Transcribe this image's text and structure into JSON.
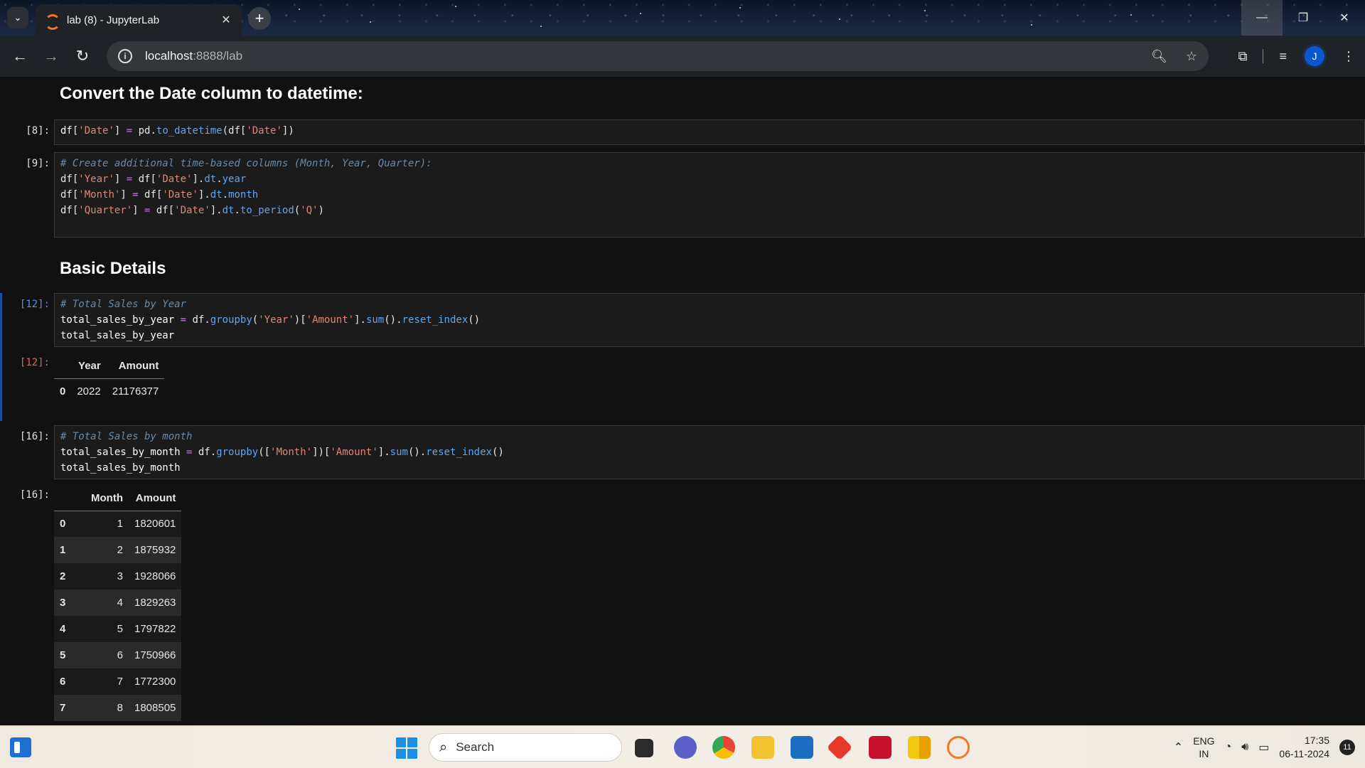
{
  "browser": {
    "tab_title": "lab (8) - JupyterLab",
    "new_tab_symbol": "+",
    "url_host": "localhost",
    "url_path": ":8888/lab",
    "profile_initial": "J"
  },
  "notebook": {
    "heading_date": "Convert the Date column to datetime:",
    "heading_basic": "Basic Details",
    "cells": {
      "c8_prompt": "[8]:",
      "c9_prompt": "[9]:",
      "c12_prompt": "[12]:",
      "c12_out_prompt": "[12]:",
      "c16_prompt": "[16]:",
      "c16_out_prompt": "[16]:"
    },
    "year_table": {
      "columns": [
        "Year",
        "Amount"
      ],
      "rows": [
        {
          "index": "0",
          "values": [
            "2022",
            "21176377"
          ]
        }
      ]
    },
    "month_table": {
      "columns": [
        "Month",
        "Amount"
      ],
      "rows": [
        {
          "index": "0",
          "values": [
            "1",
            "1820601"
          ]
        },
        {
          "index": "1",
          "values": [
            "2",
            "1875932"
          ]
        },
        {
          "index": "2",
          "values": [
            "3",
            "1928066"
          ]
        },
        {
          "index": "3",
          "values": [
            "4",
            "1829263"
          ]
        },
        {
          "index": "4",
          "values": [
            "5",
            "1797822"
          ]
        },
        {
          "index": "5",
          "values": [
            "6",
            "1750966"
          ]
        },
        {
          "index": "6",
          "values": [
            "7",
            "1772300"
          ]
        },
        {
          "index": "7",
          "values": [
            "8",
            "1808505"
          ]
        }
      ]
    }
  },
  "taskbar": {
    "search_label": "Search",
    "lang_line1": "ENG",
    "lang_line2": "IN",
    "time": "17:35",
    "date": "06-11-2024",
    "notification_count": "11"
  }
}
